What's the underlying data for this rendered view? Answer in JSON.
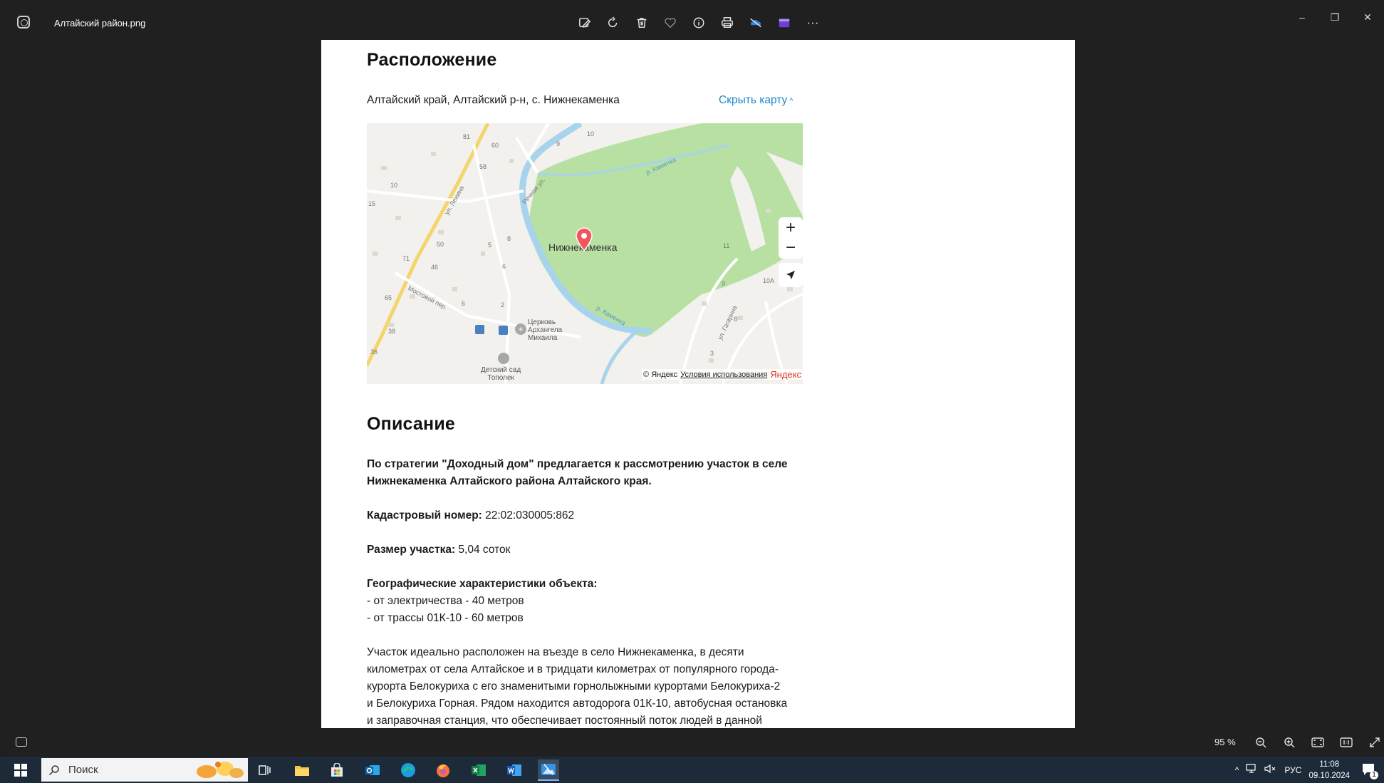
{
  "window": {
    "file_title": "Алтайский район.png",
    "minimize": "–",
    "restore": "❐",
    "close": "✕"
  },
  "toolbar": {
    "edit_icon": "edit-image-icon",
    "rotate_icon": "rotate-icon",
    "delete_icon": "delete-icon",
    "favorite_icon": "heart-icon",
    "info_icon": "info-icon",
    "print_icon": "print-icon",
    "onedrive_icon": "onedrive-icon",
    "video_icon": "clipchamp-icon",
    "more_label": "···"
  },
  "doc": {
    "location_heading": "Расположение",
    "address": "Алтайский край, Алтайский р-н, с. Нижнекаменка",
    "hide_map": "Скрыть карту",
    "map": {
      "place_label": "Нижнекаменка",
      "zoom_in": "+",
      "zoom_out": "−",
      "church_label_1": "Церковь",
      "church_label_2": "Архангела",
      "church_label_3": "Михаила",
      "kinder_label_1": "Детский сад",
      "kinder_label_2": "Тополек",
      "road_lenina": "ул. Ленина",
      "road_rechnaya": "Речная ул.",
      "road_mostovoy": "Мостовой пер.",
      "road_gagarina": "ул. Гагарина",
      "river_1": "р. Каменка",
      "river_2": "р. Каменка",
      "copyright": "© Яндекс",
      "terms": "Условия использования",
      "brand": "Яндекс",
      "numbers": [
        "81",
        "60",
        "9",
        "10",
        "58",
        "10",
        "15",
        "50",
        "71",
        "46",
        "5",
        "8",
        "6",
        "65",
        "6",
        "2",
        "38",
        "36",
        "11",
        "10А",
        "9",
        "8",
        "3"
      ]
    },
    "description_heading": "Описание",
    "intro_1": "По стратегии \"Доходный дом\" предлагается к рассмотрению участок в селе",
    "intro_2": "Нижнекаменка Алтайского района Алтайского края.",
    "cadastral_label": "Кадастровый номер:",
    "cadastral_value": " 22:02:030005:862",
    "size_label": "Размер участка:",
    "size_value": " 5,04 соток",
    "geo_label": "Географические характеристики объекта:",
    "geo_1": "- от электричества - 40 метров",
    "geo_2": "- от трассы 01К-10 - 60 метров",
    "para_1": "Участок идеально расположен на въезде в село Нижнекаменка, в десяти",
    "para_2": "километрах от села Алтайское и в тридцати километрах от популярного города-",
    "para_3": "курорта Белокуриха с его знаменитыми горнолыжными курортами Белокуриха-2",
    "para_4": "и Белокуриха Горная. Рядом находится автодорога 01К-10, автобусная остановка",
    "para_5": "и заправочная станция, что обеспечивает постоянный поток людей в данной"
  },
  "bottombar": {
    "zoom": "95 %",
    "zoom_out_icon": "zoom-out-icon",
    "zoom_in_icon": "zoom-in-icon",
    "fit_icon": "fit-to-window-icon",
    "actual_size_icon": "actual-size-icon",
    "fullscreen_icon": "fullscreen-icon"
  },
  "taskbar": {
    "search_placeholder": "Поиск",
    "language": "РУС",
    "time": "11:08",
    "date": "09.10.2024",
    "notification_count": "1"
  }
}
